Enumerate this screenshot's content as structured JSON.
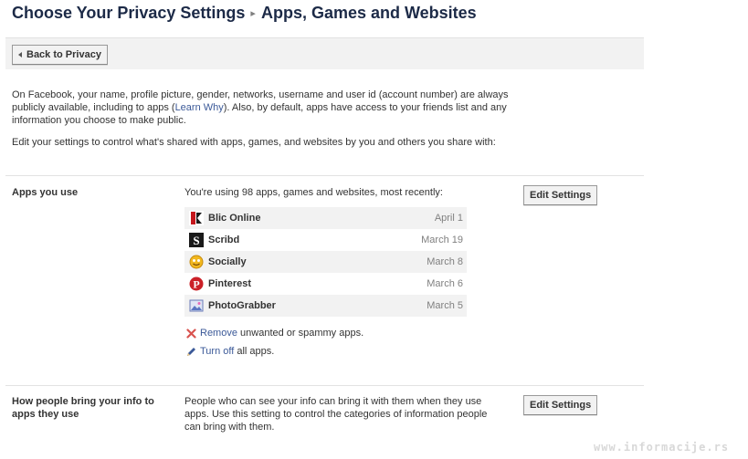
{
  "header": {
    "title": "Choose Your Privacy Settings",
    "separator": "▸",
    "subtitle": "Apps, Games and Websites"
  },
  "toolbar": {
    "back_label": "Back to Privacy"
  },
  "intro": {
    "part1": "On Facebook, your name, profile picture, gender, networks, username and user id (account number) are always publicly available, including to apps (",
    "learn_why": "Learn Why",
    "part2": "). Also, by default, apps have access to your friends list and any information you choose to make public.",
    "edit_text": "Edit your settings to control what's shared with apps, games, and websites by you and others you share with:"
  },
  "apps_section": {
    "title": "Apps you use",
    "description": "You're using 98 apps, games and websites, most recently:",
    "edit_label": "Edit Settings",
    "apps": [
      {
        "name": "Blic Online",
        "date": "April 1",
        "icon": "blic-icon"
      },
      {
        "name": "Scribd",
        "date": "March 19",
        "icon": "scribd-icon"
      },
      {
        "name": "Socially",
        "date": "March 8",
        "icon": "socially-icon"
      },
      {
        "name": "Pinterest",
        "date": "March 6",
        "icon": "pinterest-icon"
      },
      {
        "name": "PhotoGrabber",
        "date": "March 5",
        "icon": "photograbber-icon"
      }
    ],
    "remove_link": "Remove",
    "remove_rest": " unwanted or spammy apps.",
    "turnoff_link": "Turn off",
    "turnoff_rest": " all apps."
  },
  "bring_section": {
    "title": "How people bring your info to apps they use",
    "description": "People who can see your info can bring it with them when they use apps. Use this setting to control the categories of information people can bring with them.",
    "edit_label": "Edit Settings"
  },
  "watermark": "www.informacije.rs",
  "colors": {
    "link": "#3b5998",
    "title": "#1c2a47",
    "row_alt": "#f2f2f2"
  }
}
